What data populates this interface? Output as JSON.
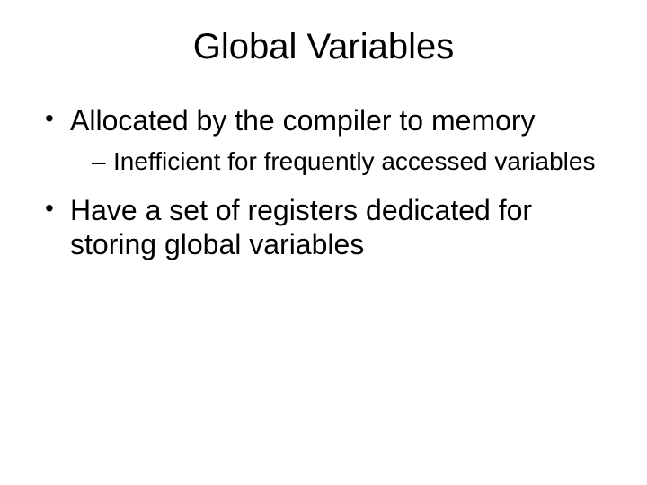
{
  "title": "Global Variables",
  "bullets": [
    {
      "text": "Allocated by the compiler to memory",
      "sub": [
        "Inefficient for frequently accessed variables"
      ]
    },
    {
      "text": "Have a set of registers dedicated for storing global variables",
      "sub": []
    }
  ]
}
